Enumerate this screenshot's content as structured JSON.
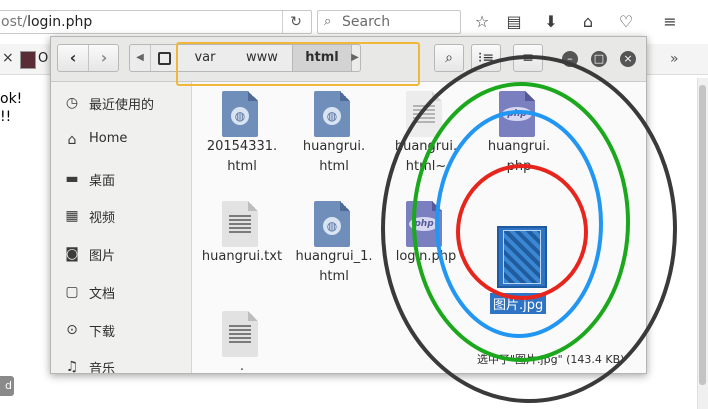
{
  "browser": {
    "url_prefix": "ost/",
    "url_path": "login.php",
    "reload_glyph": "↻",
    "search_placeholder": "Search",
    "bookmark_prefix": "O",
    "page_line1": "ok!",
    "page_line2": "!!"
  },
  "file_manager": {
    "path": [
      "var",
      "www",
      "html"
    ],
    "sidebar": [
      {
        "label": "最近使用的",
        "icon": "clock-icon",
        "glyph": "◷"
      },
      {
        "label": "Home",
        "icon": "home-icon",
        "glyph": "⌂"
      },
      {
        "label": "桌面",
        "icon": "desktop-icon",
        "glyph": "▬"
      },
      {
        "label": "视频",
        "icon": "film-icon",
        "glyph": "▦"
      },
      {
        "label": "图片",
        "icon": "camera-icon",
        "glyph": "◙"
      },
      {
        "label": "文档",
        "icon": "document-icon",
        "glyph": "▢"
      },
      {
        "label": "下载",
        "icon": "download-icon",
        "glyph": "⊙"
      },
      {
        "label": "音乐",
        "icon": "music-icon",
        "glyph": "♫"
      }
    ],
    "files": [
      {
        "name_l1": "20154331.",
        "name_l2": "html",
        "type": "html"
      },
      {
        "name_l1": "huangrui.",
        "name_l2": "html",
        "type": "html"
      },
      {
        "name_l1": "huangrui.",
        "name_l2": "html~",
        "type": "backup"
      },
      {
        "name_l1": "huangrui.",
        "name_l2": "php",
        "type": "php"
      },
      {
        "name_l1": "huangrui.txt",
        "name_l2": "",
        "type": "txt"
      },
      {
        "name_l1": "huangrui_1.",
        "name_l2": "html",
        "type": "html"
      },
      {
        "name_l1": "login.php",
        "name_l2": "",
        "type": "php"
      },
      {
        "name_l1": "图片.jpg",
        "name_l2": "",
        "type": "image"
      },
      {
        "name_l1": ".",
        "name_l2": "",
        "type": "txt"
      }
    ],
    "status": "选中了\"图片.jpg\" (143.4 KB)"
  },
  "colors": {
    "highlight_orange": "#f0b83a",
    "circle_outer": "#3a3a3a",
    "circle_green": "#1ca81c",
    "circle_blue": "#2196f3",
    "circle_red": "#e8251c",
    "selection_blue": "#2f74c4"
  }
}
